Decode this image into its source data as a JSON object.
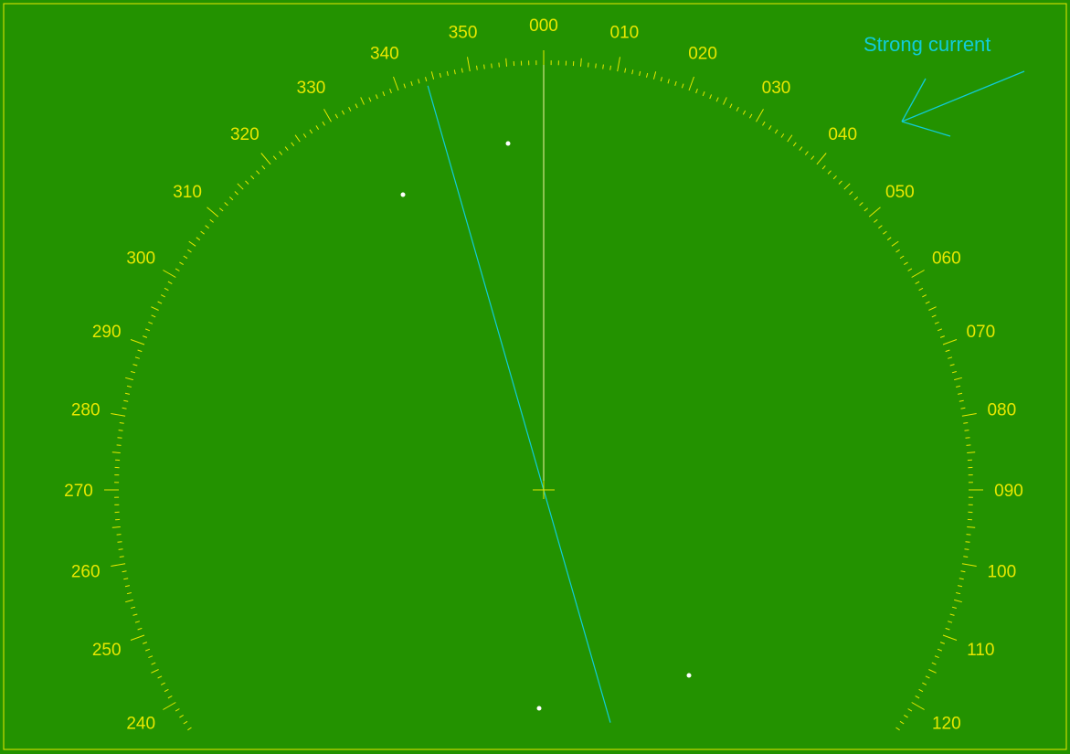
{
  "display": {
    "background_color": "#239200",
    "scale_color": "#e8e800",
    "heading_line_color": "#f4f4a0",
    "current_color": "#11ccd8",
    "echo_color": "#ffffff"
  },
  "bearing_scale": {
    "labels": [
      "000",
      "010",
      "020",
      "030",
      "040",
      "050",
      "060",
      "070",
      "080",
      "090",
      "100",
      "110",
      "120",
      "240",
      "250",
      "260",
      "270",
      "280",
      "290",
      "300",
      "310",
      "320",
      "330",
      "340",
      "350"
    ],
    "label_bearings": [
      0,
      10,
      20,
      30,
      40,
      50,
      60,
      70,
      80,
      90,
      100,
      110,
      120,
      240,
      250,
      260,
      270,
      280,
      290,
      300,
      310,
      320,
      330,
      340,
      350
    ]
  },
  "heading_bearing_deg": 0,
  "current": {
    "label": "Strong current",
    "line_bearing_deg": 344
  },
  "echoes": {
    "count": 4
  }
}
